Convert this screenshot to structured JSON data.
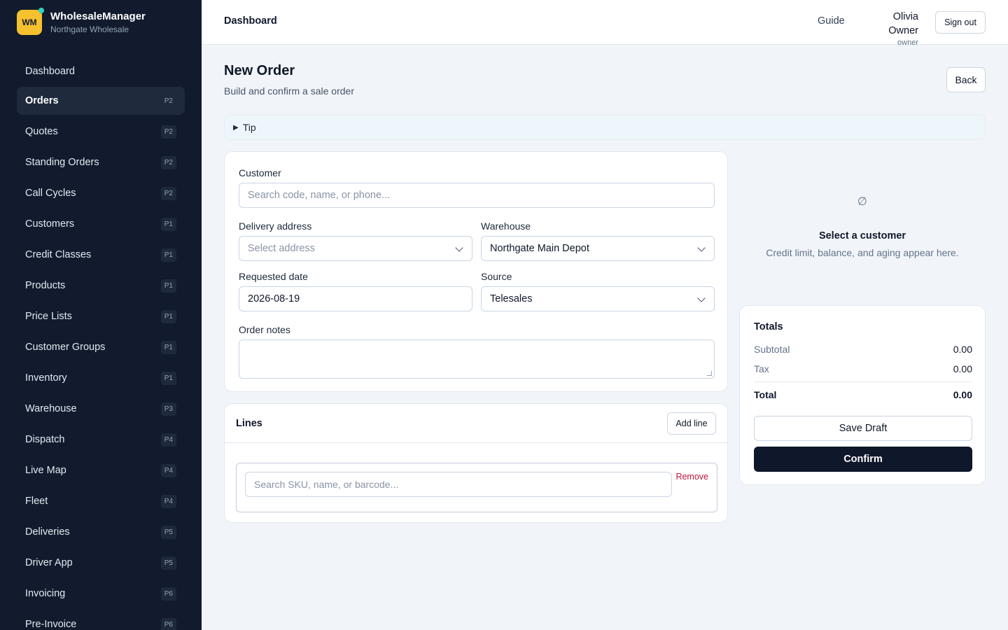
{
  "brand": {
    "logo_text": "WM",
    "name": "WholesaleManager",
    "org": "Northgate Wholesale"
  },
  "sidebar": {
    "items": [
      {
        "label": "Dashboard",
        "badge": ""
      },
      {
        "label": "Orders",
        "badge": "P2"
      },
      {
        "label": "Quotes",
        "badge": "P2"
      },
      {
        "label": "Standing Orders",
        "badge": "P2"
      },
      {
        "label": "Call Cycles",
        "badge": "P2"
      },
      {
        "label": "Customers",
        "badge": "P1"
      },
      {
        "label": "Credit Classes",
        "badge": "P1"
      },
      {
        "label": "Products",
        "badge": "P1"
      },
      {
        "label": "Price Lists",
        "badge": "P1"
      },
      {
        "label": "Customer Groups",
        "badge": "P1"
      },
      {
        "label": "Inventory",
        "badge": "P1"
      },
      {
        "label": "Warehouse",
        "badge": "P3"
      },
      {
        "label": "Dispatch",
        "badge": "P4"
      },
      {
        "label": "Live Map",
        "badge": "P4"
      },
      {
        "label": "Fleet",
        "badge": "P4"
      },
      {
        "label": "Deliveries",
        "badge": "P5"
      },
      {
        "label": "Driver App",
        "badge": "P5"
      },
      {
        "label": "Invoicing",
        "badge": "P6"
      },
      {
        "label": "Pre-Invoice",
        "badge": "P6"
      }
    ],
    "active": "Orders"
  },
  "topbar": {
    "title": "Dashboard",
    "guide": "Guide",
    "user_name": "Olivia Owner",
    "user_role": "owner",
    "signout": "Sign out"
  },
  "page": {
    "title": "New Order",
    "subtitle": "Build and confirm a sale order",
    "back": "Back",
    "tip": "Tip"
  },
  "form": {
    "customer_label": "Customer",
    "customer_placeholder": "Search code, name, or phone...",
    "delivery_label": "Delivery address",
    "delivery_value": "Select address",
    "warehouse_label": "Warehouse",
    "warehouse_value": "Northgate Main Depot",
    "date_label": "Requested date",
    "date_value": "2026-08-19",
    "source_label": "Source",
    "source_value": "Telesales",
    "notes_label": "Order notes"
  },
  "lines": {
    "title": "Lines",
    "add": "Add line",
    "search_placeholder": "Search SKU, name, or barcode...",
    "remove": "Remove"
  },
  "customer_panel": {
    "icon": "empty-set-icon",
    "title": "Select a customer",
    "description": "Credit limit, balance, and aging appear here."
  },
  "totals": {
    "title": "Totals",
    "subtotal_label": "Subtotal",
    "subtotal": "0.00",
    "tax_label": "Tax",
    "tax": "0.00",
    "total_label": "Total",
    "total": "0.00",
    "save_draft": "Save Draft",
    "confirm": "Confirm"
  },
  "colors": {
    "sidebar_bg": "#121b2e",
    "accent": "#f5c12e",
    "primary_button": "#0f172a",
    "danger": "#be123c"
  }
}
